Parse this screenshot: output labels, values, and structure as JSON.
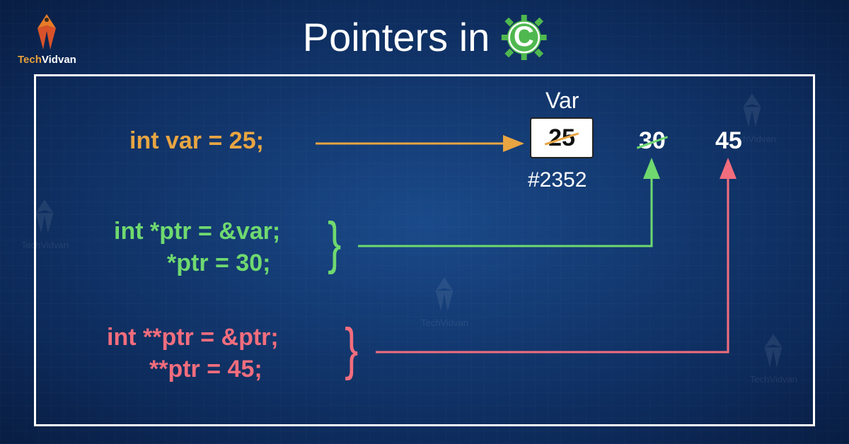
{
  "title": "Pointers in",
  "gear_letter": "C",
  "logo": {
    "name": "TechVidvan",
    "prefix": "Tech",
    "suffix": "Vidvan"
  },
  "code": {
    "orange": "int var = 25;",
    "green_line1": "int *ptr = &var;",
    "green_line2": "*ptr = 30;",
    "pink_line1": "int **ptr = &ptr;",
    "pink_line2": "**ptr = 45;"
  },
  "memory": {
    "var_label": "Var",
    "var_value": "25",
    "var_address": "#2352",
    "val_green": "30",
    "val_pink": "45"
  },
  "colors": {
    "orange": "#e8a542",
    "green": "#6fd96f",
    "pink": "#f26d7d"
  }
}
